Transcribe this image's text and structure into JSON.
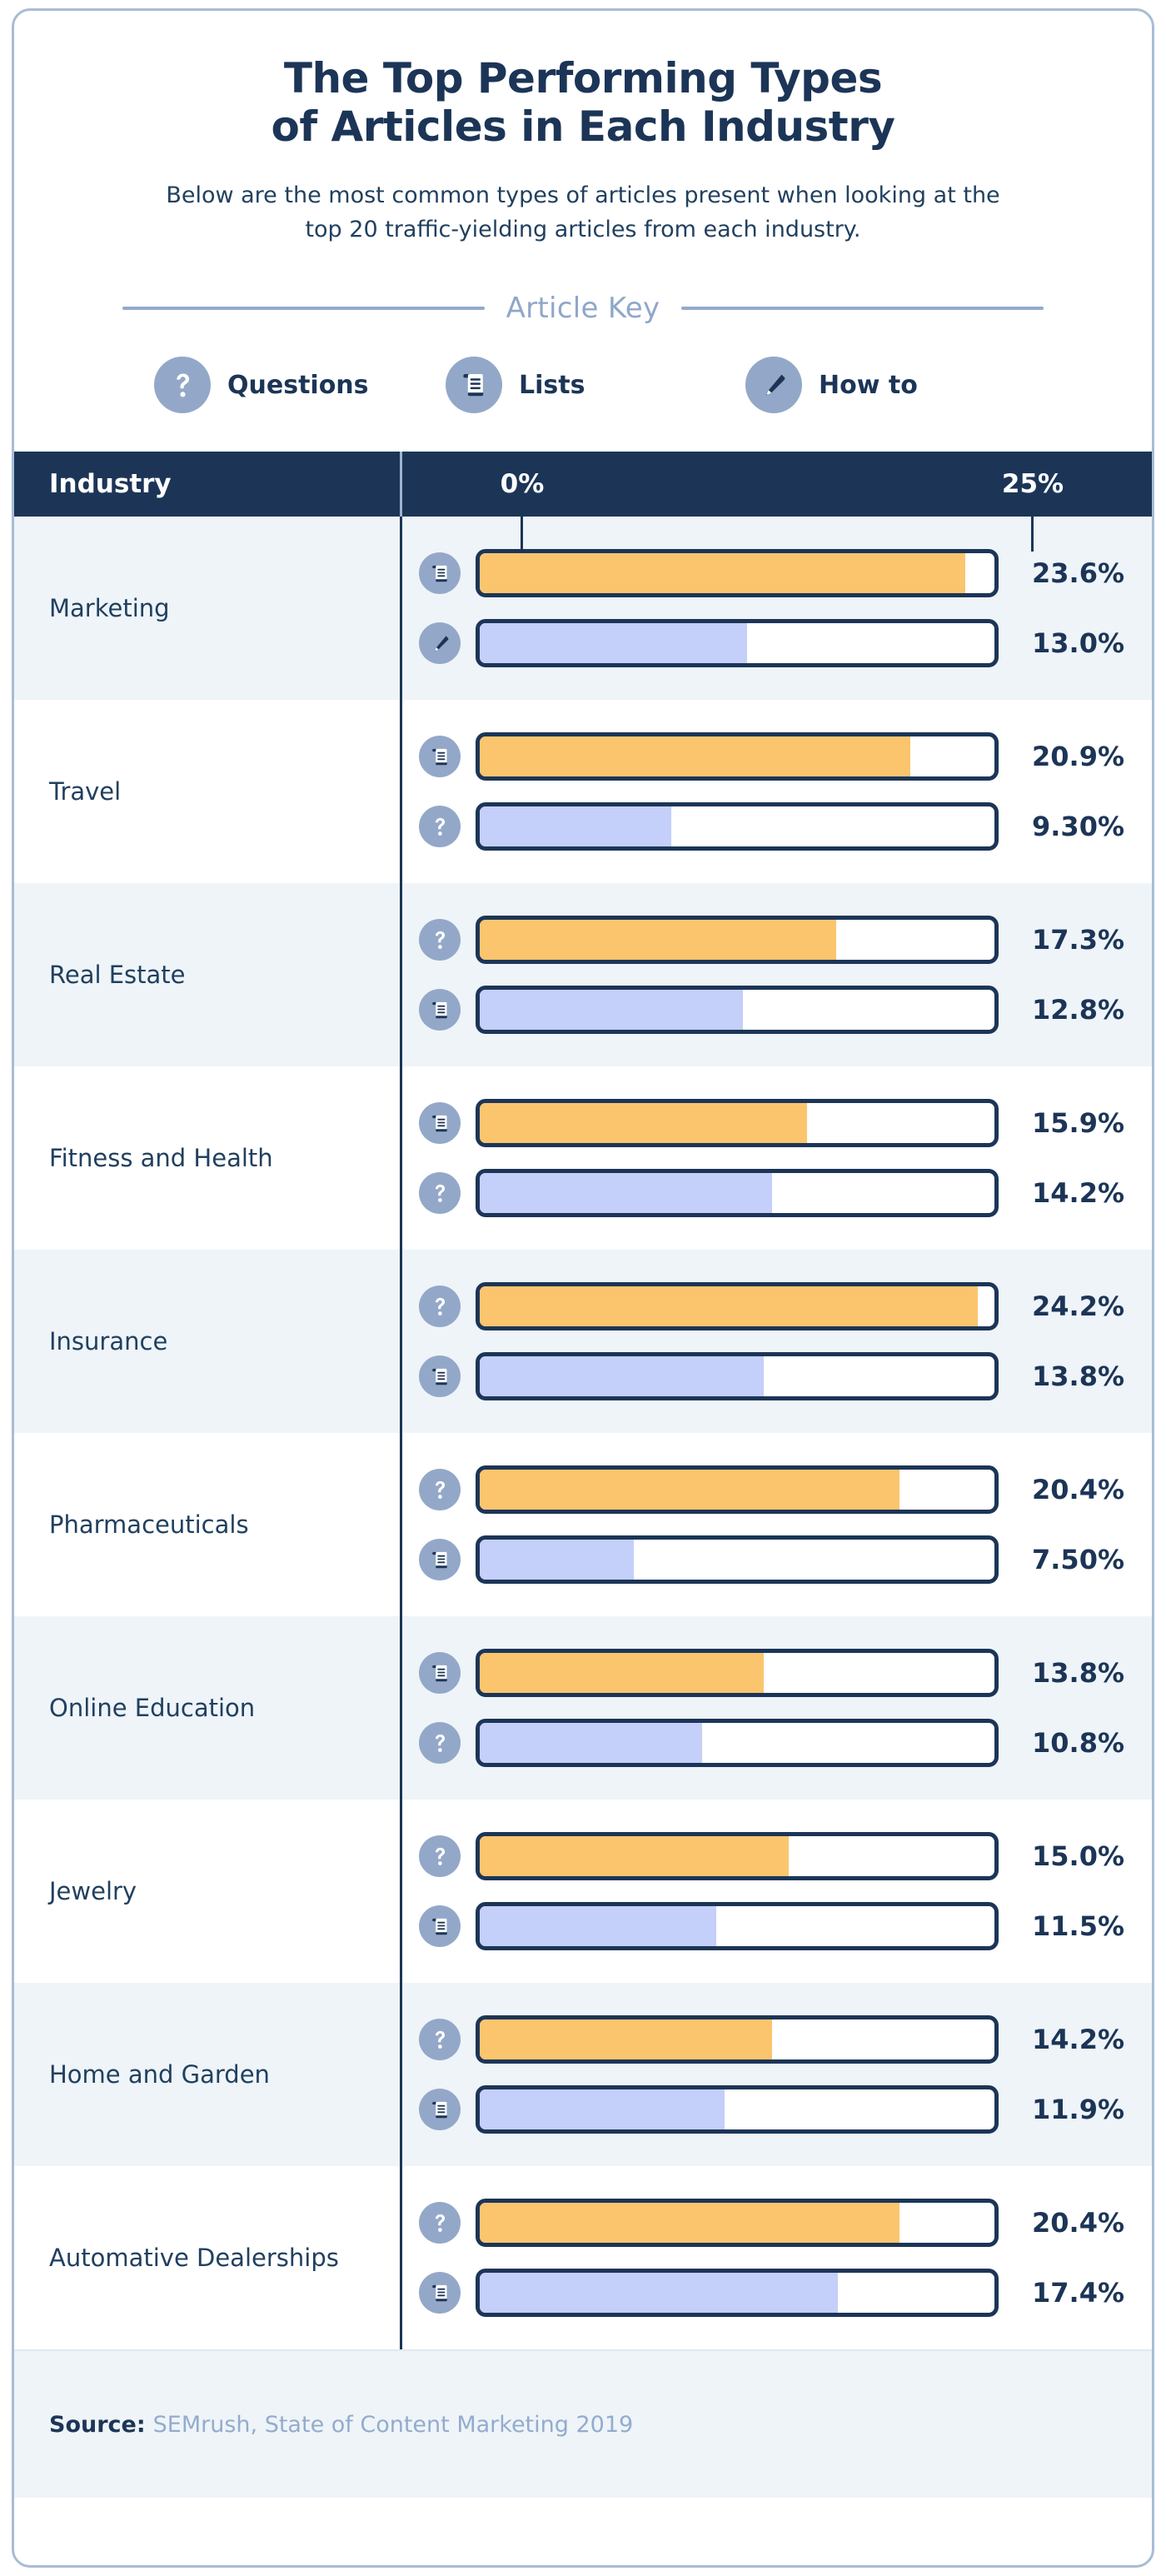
{
  "header": {
    "title_line1": "The Top Performing Types",
    "title_line2": "of Articles in Each Industry",
    "subtitle_line1": "Below are the most common types of articles present when looking at the",
    "subtitle_line2": "top 20 traffic-yielding articles from each industry."
  },
  "article_key": {
    "title": "Article Key",
    "items": [
      {
        "icon": "question-mark-icon",
        "label": "Questions"
      },
      {
        "icon": "list-document-icon",
        "label": "Lists"
      },
      {
        "icon": "pencil-icon",
        "label": "How to"
      }
    ]
  },
  "table": {
    "header": {
      "industry": "Industry",
      "tick_min": "0%",
      "tick_max": "25%"
    }
  },
  "footer": {
    "source_label": "Source:",
    "source_text": "SEMrush, State of Content Marketing 2019"
  },
  "colors": {
    "navy": "#1c3557",
    "orange_bar": "#fbc56e",
    "blue_bar": "#c4cffa",
    "icon_circle": "#93a8c8",
    "row_alt": "#eef4f8",
    "card_border": "#a9bcd6",
    "key_title": "#8fa7ca",
    "source_text": "#94abce"
  },
  "chart_data": {
    "type": "bar",
    "title": "The Top Performing Types of Articles in Each Industry",
    "subtitle": "Below are the most common types of articles present when looking at the top 20 traffic-yielding articles from each industry.",
    "orientation": "horizontal",
    "xlabel": "",
    "ylabel": "Industry",
    "xlim": [
      0,
      25
    ],
    "xticks": [
      0,
      25
    ],
    "xticklabels": [
      "0%",
      "25%"
    ],
    "grid": false,
    "legend_position": "top",
    "legend": [
      {
        "name": "Questions",
        "icon": "question-mark-icon"
      },
      {
        "name": "Lists",
        "icon": "list-document-icon"
      },
      {
        "name": "How to",
        "icon": "pencil-icon"
      }
    ],
    "source": "SEMrush, State of Content Marketing 2019",
    "categories": [
      "Marketing",
      "Travel",
      "Real Estate",
      "Fitness and Health",
      "Insurance",
      "Pharmaceuticals",
      "Online Education",
      "Jewelry",
      "Home and Garden",
      "Automative Dealerships"
    ],
    "rows": [
      {
        "industry": "Marketing",
        "bars": [
          {
            "icon": "list-document-icon",
            "type": "Lists",
            "value": 23.6,
            "label": "23.6%",
            "color": "orange"
          },
          {
            "icon": "pencil-icon",
            "type": "How to",
            "value": 13.0,
            "label": "13.0%",
            "color": "blue"
          }
        ]
      },
      {
        "industry": "Travel",
        "bars": [
          {
            "icon": "list-document-icon",
            "type": "Lists",
            "value": 20.9,
            "label": "20.9%",
            "color": "orange"
          },
          {
            "icon": "question-mark-icon",
            "type": "Questions",
            "value": 9.3,
            "label": "9.30%",
            "color": "blue"
          }
        ]
      },
      {
        "industry": "Real Estate",
        "bars": [
          {
            "icon": "question-mark-icon",
            "type": "Questions",
            "value": 17.3,
            "label": "17.3%",
            "color": "orange"
          },
          {
            "icon": "list-document-icon",
            "type": "Lists",
            "value": 12.8,
            "label": "12.8%",
            "color": "blue"
          }
        ]
      },
      {
        "industry": "Fitness and Health",
        "bars": [
          {
            "icon": "list-document-icon",
            "type": "Lists",
            "value": 15.9,
            "label": "15.9%",
            "color": "orange"
          },
          {
            "icon": "question-mark-icon",
            "type": "Questions",
            "value": 14.2,
            "label": "14.2%",
            "color": "blue"
          }
        ]
      },
      {
        "industry": "Insurance",
        "bars": [
          {
            "icon": "question-mark-icon",
            "type": "Questions",
            "value": 24.2,
            "label": "24.2%",
            "color": "orange"
          },
          {
            "icon": "list-document-icon",
            "type": "Lists",
            "value": 13.8,
            "label": "13.8%",
            "color": "blue"
          }
        ]
      },
      {
        "industry": "Pharmaceuticals",
        "bars": [
          {
            "icon": "question-mark-icon",
            "type": "Questions",
            "value": 20.4,
            "label": "20.4%",
            "color": "orange"
          },
          {
            "icon": "list-document-icon",
            "type": "Lists",
            "value": 7.5,
            "label": "7.50%",
            "color": "blue"
          }
        ]
      },
      {
        "industry": "Online Education",
        "bars": [
          {
            "icon": "list-document-icon",
            "type": "Lists",
            "value": 13.8,
            "label": "13.8%",
            "color": "orange"
          },
          {
            "icon": "question-mark-icon",
            "type": "Questions",
            "value": 10.8,
            "label": "10.8%",
            "color": "blue"
          }
        ]
      },
      {
        "industry": "Jewelry",
        "bars": [
          {
            "icon": "question-mark-icon",
            "type": "Questions",
            "value": 15.0,
            "label": "15.0%",
            "color": "orange"
          },
          {
            "icon": "list-document-icon",
            "type": "Lists",
            "value": 11.5,
            "label": "11.5%",
            "color": "blue"
          }
        ]
      },
      {
        "industry": "Home and Garden",
        "bars": [
          {
            "icon": "question-mark-icon",
            "type": "Questions",
            "value": 14.2,
            "label": "14.2%",
            "color": "orange"
          },
          {
            "icon": "list-document-icon",
            "type": "Lists",
            "value": 11.9,
            "label": "11.9%",
            "color": "blue"
          }
        ]
      },
      {
        "industry": "Automative Dealerships",
        "bars": [
          {
            "icon": "question-mark-icon",
            "type": "Questions",
            "value": 20.4,
            "label": "20.4%",
            "color": "orange"
          },
          {
            "icon": "list-document-icon",
            "type": "Lists",
            "value": 17.4,
            "label": "17.4%",
            "color": "blue"
          }
        ]
      }
    ]
  }
}
